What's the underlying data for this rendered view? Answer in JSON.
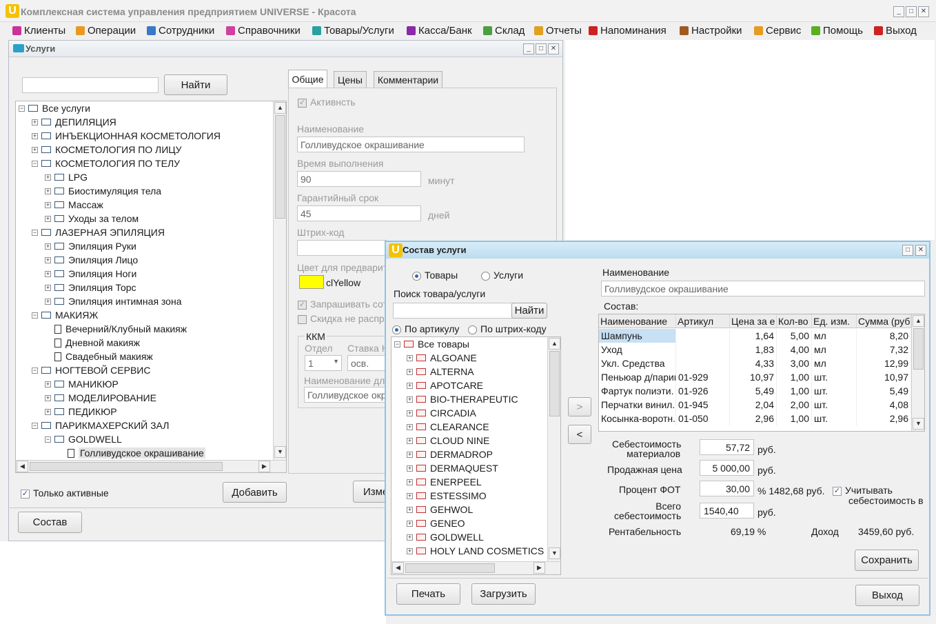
{
  "app": {
    "title": "Комплексная система управления предприятием UNIVERSE - Красота",
    "logo": "U"
  },
  "menu": [
    {
      "label": "Клиенты",
      "icon": "clients-icon",
      "color": "#cc3399"
    },
    {
      "label": "Операции",
      "icon": "operations-icon",
      "color": "#e89a20"
    },
    {
      "label": "Сотрудники",
      "icon": "employees-icon",
      "color": "#3a78c8"
    },
    {
      "label": "Справочники",
      "icon": "reference-books-icon",
      "color": "#d040a0"
    },
    {
      "label": "Товары/Услуги",
      "icon": "goods-services-icon",
      "color": "#2aa0a0"
    },
    {
      "label": "Касса/Банк",
      "icon": "cashbox-icon",
      "color": "#8a2aa8"
    },
    {
      "label": "Склад",
      "icon": "warehouse-icon",
      "color": "#4aa040"
    },
    {
      "label": "Отчеты",
      "icon": "reports-icon",
      "color": "#e0a020"
    },
    {
      "label": "Напоминания",
      "icon": "reminders-icon",
      "color": "#cc2222"
    },
    {
      "label": "Настройки",
      "icon": "settings-icon",
      "color": "#a05a20"
    },
    {
      "label": "Сервис",
      "icon": "service-icon",
      "color": "#e89a20"
    },
    {
      "label": "Помощь",
      "icon": "help-icon",
      "color": "#58b020"
    },
    {
      "label": "Выход",
      "icon": "exit-icon",
      "color": "#cc2222"
    }
  ],
  "services": {
    "title": "Услуги",
    "search_placeholder": "",
    "find_label": "Найти",
    "tree": [
      {
        "label": "Все услуги",
        "level": 0,
        "exp": "-",
        "kind": "folder"
      },
      {
        "label": "ДЕПИЛЯЦИЯ",
        "level": 1,
        "exp": "+",
        "kind": "folder"
      },
      {
        "label": "ИНЪЕКЦИОННАЯ КОСМЕТОЛОГИЯ",
        "level": 1,
        "exp": "+",
        "kind": "folder"
      },
      {
        "label": "КОСМЕТОЛОГИЯ ПО ЛИЦУ",
        "level": 1,
        "exp": "+",
        "kind": "folder"
      },
      {
        "label": "КОСМЕТОЛОГИЯ ПО ТЕЛУ",
        "level": 1,
        "exp": "-",
        "kind": "folder"
      },
      {
        "label": "LPG",
        "level": 2,
        "exp": "+",
        "kind": "folder"
      },
      {
        "label": "Биостимуляция тела",
        "level": 2,
        "exp": "+",
        "kind": "folder"
      },
      {
        "label": "Массаж",
        "level": 2,
        "exp": "+",
        "kind": "folder"
      },
      {
        "label": "Уходы за телом",
        "level": 2,
        "exp": "+",
        "kind": "folder"
      },
      {
        "label": "ЛАЗЕРНАЯ ЭПИЛЯЦИЯ",
        "level": 1,
        "exp": "-",
        "kind": "folder"
      },
      {
        "label": "Эпиляция  Руки",
        "level": 2,
        "exp": "+",
        "kind": "folder"
      },
      {
        "label": "Эпиляция Лицо",
        "level": 2,
        "exp": "+",
        "kind": "folder"
      },
      {
        "label": "Эпиляция Ноги",
        "level": 2,
        "exp": "+",
        "kind": "folder"
      },
      {
        "label": "Эпиляция Торс",
        "level": 2,
        "exp": "+",
        "kind": "folder"
      },
      {
        "label": "Эпиляция интимная зона",
        "level": 2,
        "exp": "+",
        "kind": "folder"
      },
      {
        "label": "МАКИЯЖ",
        "level": 1,
        "exp": "-",
        "kind": "folder"
      },
      {
        "label": "Вечерний/Клубный макияж",
        "level": 2,
        "exp": "",
        "kind": "doc"
      },
      {
        "label": "Дневной макияж",
        "level": 2,
        "exp": "",
        "kind": "doc"
      },
      {
        "label": "Свадебный макияж",
        "level": 2,
        "exp": "",
        "kind": "doc"
      },
      {
        "label": "НОГТЕВОЙ СЕРВИС",
        "level": 1,
        "exp": "-",
        "kind": "folder"
      },
      {
        "label": "МАНИКЮР",
        "level": 2,
        "exp": "+",
        "kind": "folder"
      },
      {
        "label": "МОДЕЛИРОВАНИЕ",
        "level": 2,
        "exp": "+",
        "kind": "folder"
      },
      {
        "label": "ПЕДИКЮР",
        "level": 2,
        "exp": "+",
        "kind": "folder"
      },
      {
        "label": "ПАРИКМАХЕРСКИЙ ЗАЛ",
        "level": 1,
        "exp": "-",
        "kind": "folder"
      },
      {
        "label": "GOLDWELL",
        "level": 2,
        "exp": "-",
        "kind": "folder"
      },
      {
        "label": "Голливудское окрашивание",
        "level": 3,
        "exp": "",
        "kind": "doc",
        "selected": true
      }
    ],
    "only_active_label": "Только активные",
    "add_label": "Добавить",
    "edit_label": "Изме",
    "composition_label": "Состав",
    "tabs": [
      "Общие",
      "Цены",
      "Комментарии"
    ],
    "form": {
      "active_label": "Активнсть",
      "name_label": "Наименование",
      "name_value": "Голливудское окрашивание",
      "time_label": "Время выполнения",
      "time_value": "90",
      "time_unit": "минут",
      "warranty_label": "Гарантийный срок",
      "warranty_value": "45",
      "warranty_unit": "дней",
      "barcode_label": "Штрих-код",
      "color_label": "Цвет для предварит",
      "color_value": "clYellow",
      "color_hex": "#ffff00",
      "ask_label": "Запрашивать сот",
      "discount_label": "Скидка не распр",
      "kkm_label": "ККМ",
      "dept_label": "Отдел",
      "rate_label": "Ставка Н",
      "dept_value": "1",
      "rate_value": "осв.",
      "kkm_name_label": "Наименование для",
      "kkm_name_value": "Голливудское окр"
    }
  },
  "composition": {
    "title": "Состав услуги",
    "radio_goods": "Товары",
    "radio_services": "Услуги",
    "search_label": "Поиск товара/услуги",
    "find_label": "Найти",
    "by_article": "По артикулу",
    "by_barcode": "По штрих-коду",
    "goods_tree": [
      "Все товары",
      "ALGOANE",
      "ALTERNA",
      "APOTCARE",
      "BIO-THERAPEUTIC",
      "CIRCADIA",
      "CLEARANCE",
      "CLOUD NINE",
      "DERMADROP",
      "DERMAQUEST",
      "ENERPEEL",
      "ESTESSIMO",
      "GEHWOL",
      "GENEO",
      "GOLDWELL",
      "HOLY LAND COSMETICS"
    ],
    "add_arrow": ">",
    "remove_arrow": "<",
    "name_label": "Наименование",
    "name_value": "Голливудское окрашивание",
    "composition_label": "Состав:",
    "columns": [
      "Наименование",
      "Артикул",
      "Цена за е",
      "Кол-во",
      "Ед. изм.",
      "Сумма (руб"
    ],
    "rows": [
      [
        "Шампунь",
        "",
        "1,64",
        "5,00",
        "мл",
        "8,20"
      ],
      [
        "Уход",
        "",
        "1,83",
        "4,00",
        "мл",
        "7,32"
      ],
      [
        "Укл. Средства",
        "",
        "4,33",
        "3,00",
        "мл",
        "12,99"
      ],
      [
        "Пеньюар д/парик",
        "01-929",
        "10,97",
        "1,00",
        "шт.",
        "10,97"
      ],
      [
        "Фартук полиэти.",
        "01-926",
        "5,49",
        "1,00",
        "шт.",
        "5,49"
      ],
      [
        "Перчатки винил.",
        "01-945",
        "2,04",
        "2,00",
        "шт.",
        "4,08"
      ],
      [
        "Косынка-воротн.",
        "01-050",
        "2,96",
        "1,00",
        "шт.",
        "2,96"
      ]
    ],
    "cost_label_1": "Себестоимость",
    "cost_label_2": "материалов",
    "cost_value": "57,72",
    "sale_label": "Продажная цена",
    "sale_value": "5 000,00",
    "fot_label": "Процент ФОТ",
    "fot_value": "30,00",
    "fot_suffix": "% 1482,68 руб.",
    "consider_label_1": "Учитывать",
    "consider_label_2": "себестоимость в",
    "total_label_1": "Всего",
    "total_label_2": "себестоимость",
    "total_value": "1540,40",
    "rub": "руб.",
    "profit_label": "Рентабельность",
    "profit_value": "69,19 %",
    "income_label": "Доход",
    "income_value": "3459,60  руб.",
    "save_label": "Сохранить",
    "print_label": "Печать",
    "load_label": "Загрузить",
    "exit_label": "Выход"
  }
}
